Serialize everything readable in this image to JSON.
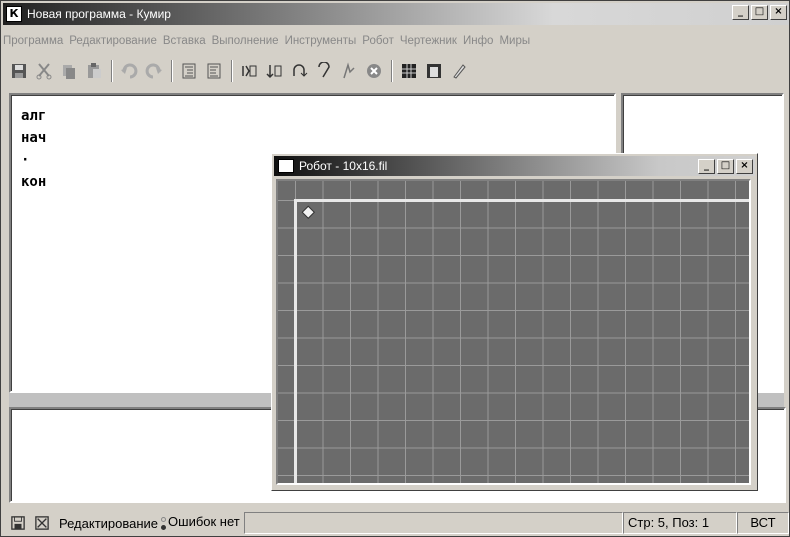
{
  "window": {
    "title": "Новая программа - Кумир",
    "app_icon_letter": "К"
  },
  "menu": [
    "Программа",
    "Редактирование",
    "Вставка",
    "Выполнение",
    "Инструменты",
    "Робот",
    "Чертежник",
    "Инфо",
    "Миры"
  ],
  "toolbar": {
    "buttons": [
      "save-icon",
      "cut-icon",
      "copy-icon",
      "paste-icon",
      "undo-icon",
      "redo-icon",
      "indent-icon",
      "unindent-icon",
      "step-over-icon",
      "step-into-icon",
      "run-icon",
      "step-out-icon",
      "debug-icon",
      "stop-icon",
      "grid-icon",
      "window-icon",
      "pen-icon"
    ]
  },
  "editor": {
    "lines": [
      "алг",
      "нач",
      "·",
      "кон"
    ]
  },
  "robot_window": {
    "title": "Робот - 10x16.fil",
    "grid_cols": 17,
    "grid_rows": 11,
    "robot_col": 0,
    "robot_row": 0,
    "field_color": "#6b6b6b",
    "wall_color": "#e8e8e8"
  },
  "statusbar": {
    "mode": "Редактирование",
    "errors": "Ошибок нет",
    "position": "Стр: 5, Поз: 1",
    "insert_mode": "ВСТ"
  }
}
